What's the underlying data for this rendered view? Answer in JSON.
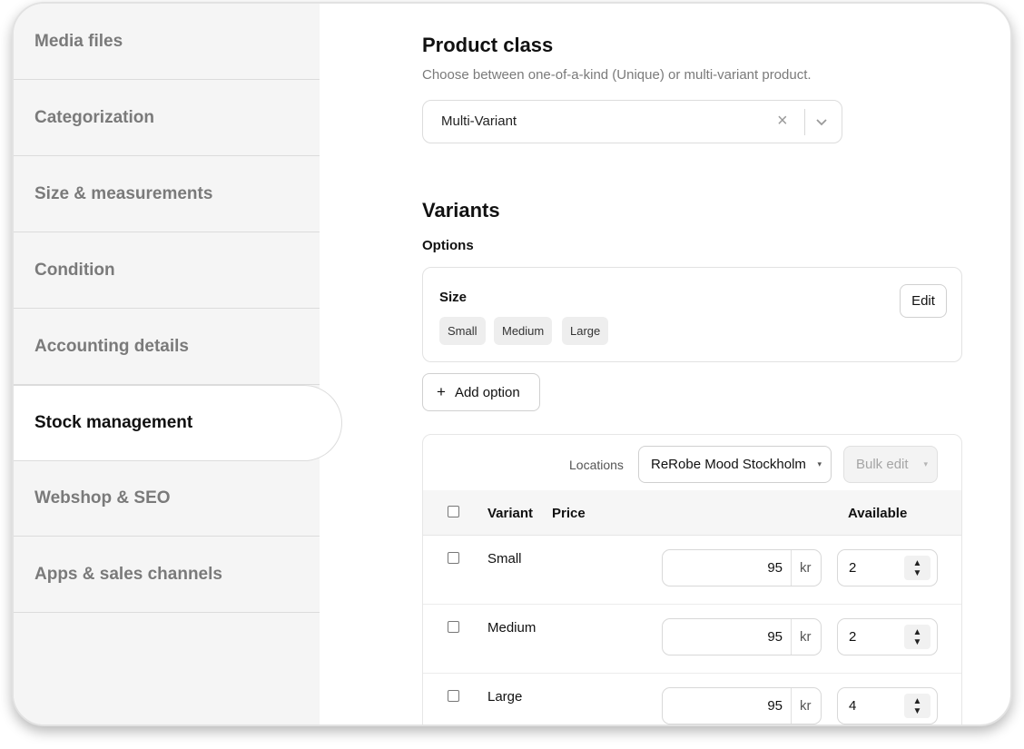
{
  "sidebar": {
    "items": [
      {
        "label": "Media files"
      },
      {
        "label": "Categorization"
      },
      {
        "label": "Size & measurements"
      },
      {
        "label": "Condition"
      },
      {
        "label": "Accounting details"
      },
      {
        "label": "Stock management"
      },
      {
        "label": "Webshop & SEO"
      },
      {
        "label": "Apps & sales channels"
      }
    ],
    "active": "Stock management"
  },
  "product_class": {
    "title": "Product class",
    "description": "Choose between one-of-a-kind (Unique) or multi-variant product.",
    "selected": "Multi-Variant",
    "clear_icon": "×"
  },
  "variants": {
    "title": "Variants",
    "options_label": "Options",
    "option": {
      "name": "Size",
      "values": [
        "Small",
        "Medium",
        "Large"
      ],
      "edit_label": "Edit"
    },
    "add_option_label": "Add option",
    "add_icon": "+"
  },
  "stock": {
    "locations_label": "Locations",
    "location_selected": "ReRobe Mood Stockholm",
    "bulk_edit_label": "Bulk edit",
    "caret": "▾",
    "headers": {
      "variant": "Variant",
      "price": "Price",
      "available": "Available"
    },
    "currency": "kr",
    "rows": [
      {
        "name": "Small",
        "price": "95",
        "available": "2"
      },
      {
        "name": "Medium",
        "price": "95",
        "available": "2"
      },
      {
        "name": "Large",
        "price": "95",
        "available": "4"
      }
    ],
    "spinner_up": "▲",
    "spinner_down": "▼"
  }
}
